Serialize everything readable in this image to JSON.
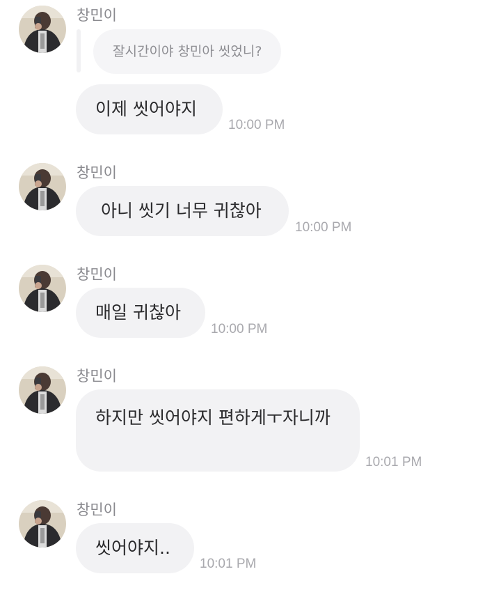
{
  "messages": [
    {
      "sender": "창민이",
      "quote": "잘시간이야 창민아 씻었니?",
      "text": "이제 씻어야지",
      "time": "10:00 PM"
    },
    {
      "sender": "창민이",
      "text": " 아니 씻기 너무 귀찮아",
      "time": "10:00 PM"
    },
    {
      "sender": "창민이",
      "text": "매일 귀찮아",
      "time": "10:00 PM"
    },
    {
      "sender": "창민이",
      "text": "하지만 씻어야지 편하게ㅜ자니까",
      "time": "10:01 PM"
    },
    {
      "sender": "창민이",
      "text": "씻어야지..",
      "time": "10:01 PM"
    }
  ],
  "colors": {
    "bubble": "#f2f2f4",
    "sender": "#8a8a8f",
    "time": "#a9a9ae",
    "text": "#2a2a2c"
  },
  "icons": {
    "avatar": "profile-photo-avatar"
  }
}
